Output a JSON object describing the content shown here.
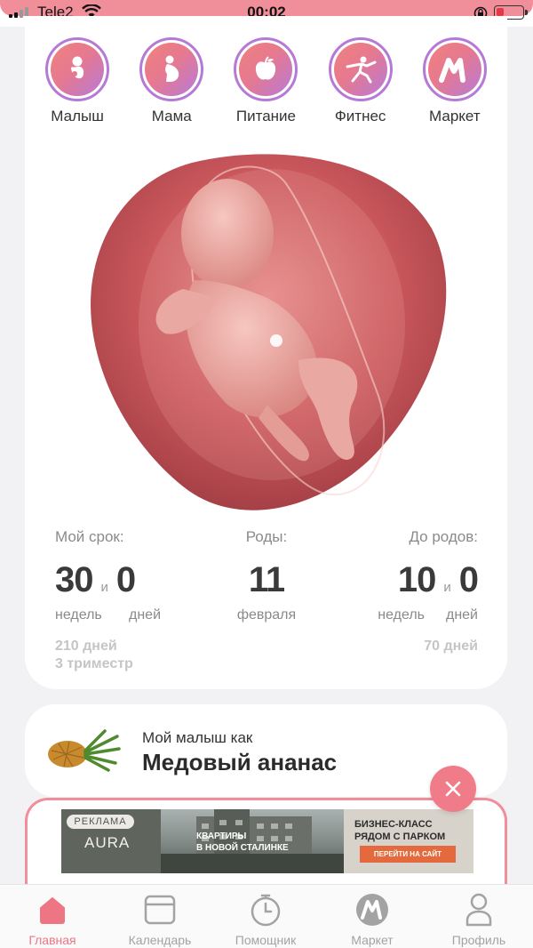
{
  "status_bar": {
    "carrier": "Tele2",
    "time": "00:02"
  },
  "categories": [
    {
      "label": "Малыш",
      "icon": "baby-icon"
    },
    {
      "label": "Мама",
      "icon": "mom-icon"
    },
    {
      "label": "Питание",
      "icon": "apple-icon"
    },
    {
      "label": "Фитнес",
      "icon": "fitness-icon"
    },
    {
      "label": "Маркет",
      "icon": "market-icon"
    }
  ],
  "stats": {
    "term": {
      "label": "Мой срок:",
      "weeks": "30",
      "days": "0",
      "and": "и",
      "weeks_unit": "недель",
      "days_unit": "дней",
      "total_days": "210 дней",
      "trimester": "3 триместр"
    },
    "due": {
      "label": "Роды:",
      "day": "11",
      "month": "февраля"
    },
    "left": {
      "label": "До родов:",
      "weeks": "10",
      "days": "0",
      "and": "и",
      "weeks_unit": "недель",
      "days_unit": "дней",
      "total_days": "70 дней"
    }
  },
  "fruit": {
    "subtitle": "Мой малыш как",
    "name": "Медовый ананас"
  },
  "ad": {
    "tag": "РЕКЛАМА",
    "brand": "AURA",
    "photo_text_1": "КВАРТИРЫ",
    "photo_text_2": "В НОВОЙ СТАЛИНКЕ",
    "headline_1": "БИЗНЕС-КЛАСС",
    "headline_2": "РЯДОМ С ПАРКОМ",
    "cta": "ПЕРЕЙТИ НА САЙТ"
  },
  "tabs": [
    {
      "label": "Главная",
      "active": true
    },
    {
      "label": "Календарь",
      "active": false
    },
    {
      "label": "Помощник",
      "active": false
    },
    {
      "label": "Маркет",
      "active": false
    },
    {
      "label": "Профиль",
      "active": false
    }
  ],
  "colors": {
    "accent": "#ee7583",
    "ring": "#b57ad7",
    "status_pink": "#f08e9a"
  }
}
